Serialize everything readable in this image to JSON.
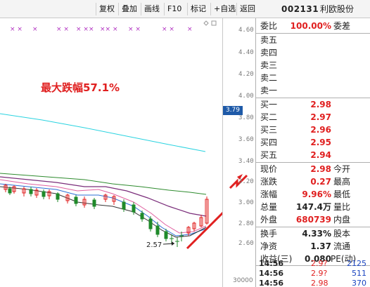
{
  "toolbar": {
    "buttons": [
      "复权",
      "叠加",
      "画线",
      "F10",
      "标记",
      "+自选",
      "返回"
    ],
    "stock_code": "002131",
    "stock_name": "利欧股份"
  },
  "chart": {
    "annotation": "最大跌幅57.1%",
    "low_label": "2.57",
    "current_price_tag": "3.79",
    "y_ticks": [
      "4.60",
      "4.40",
      "4.20",
      "4.00",
      "3.80",
      "3.60",
      "3.40",
      "3.20",
      "3.00",
      "2.80",
      "2.60"
    ],
    "volume_label": "30000",
    "marker_row": [
      "×",
      "×",
      "×",
      "×",
      "×",
      "×",
      "×",
      "×",
      "×",
      "×",
      "×",
      "×",
      "×",
      "×",
      "×",
      "×",
      "×",
      "×",
      "×",
      "×"
    ]
  },
  "quote_panel": {
    "weibi_label": "委比",
    "weibi_value": "100.00%",
    "weicha_label": "委差",
    "sell_labels": [
      "卖五",
      "卖四",
      "卖三",
      "卖二",
      "卖一"
    ],
    "buy_levels": [
      {
        "label": "买一",
        "price": "2.98"
      },
      {
        "label": "买二",
        "price": "2.97"
      },
      {
        "label": "买三",
        "price": "2.96"
      },
      {
        "label": "买四",
        "price": "2.95"
      },
      {
        "label": "买五",
        "price": "2.94"
      }
    ],
    "stats": [
      {
        "label": "现价",
        "value": "2.98",
        "label2": "今开",
        "color": "red"
      },
      {
        "label": "涨跌",
        "value": "0.27",
        "label2": "最高",
        "color": "red"
      },
      {
        "label": "涨幅",
        "value": "9.96%",
        "label2": "最低",
        "color": "red"
      },
      {
        "label": "总量",
        "value": "147.4万",
        "label2": "量比",
        "color": "dark"
      },
      {
        "label": "外盘",
        "value": "680739",
        "label2": "内盘",
        "color": "red"
      }
    ],
    "stats2": [
      {
        "label": "换手",
        "value": "4.33%",
        "label2": "股本",
        "color": "dark"
      },
      {
        "label": "净资",
        "value": "1.37",
        "label2": "流通",
        "color": "dark"
      },
      {
        "label": "收益(三)",
        "value": "0.080",
        "label2": "PE(动)",
        "color": "dark"
      }
    ],
    "ticks": [
      {
        "time": "14:56",
        "price": "2.9?",
        "vol": "2125"
      },
      {
        "time": "14:56",
        "price": "2.9?",
        "vol": "511"
      },
      {
        "time": "14:56",
        "price": "2.98",
        "vol": "370"
      }
    ]
  }
}
